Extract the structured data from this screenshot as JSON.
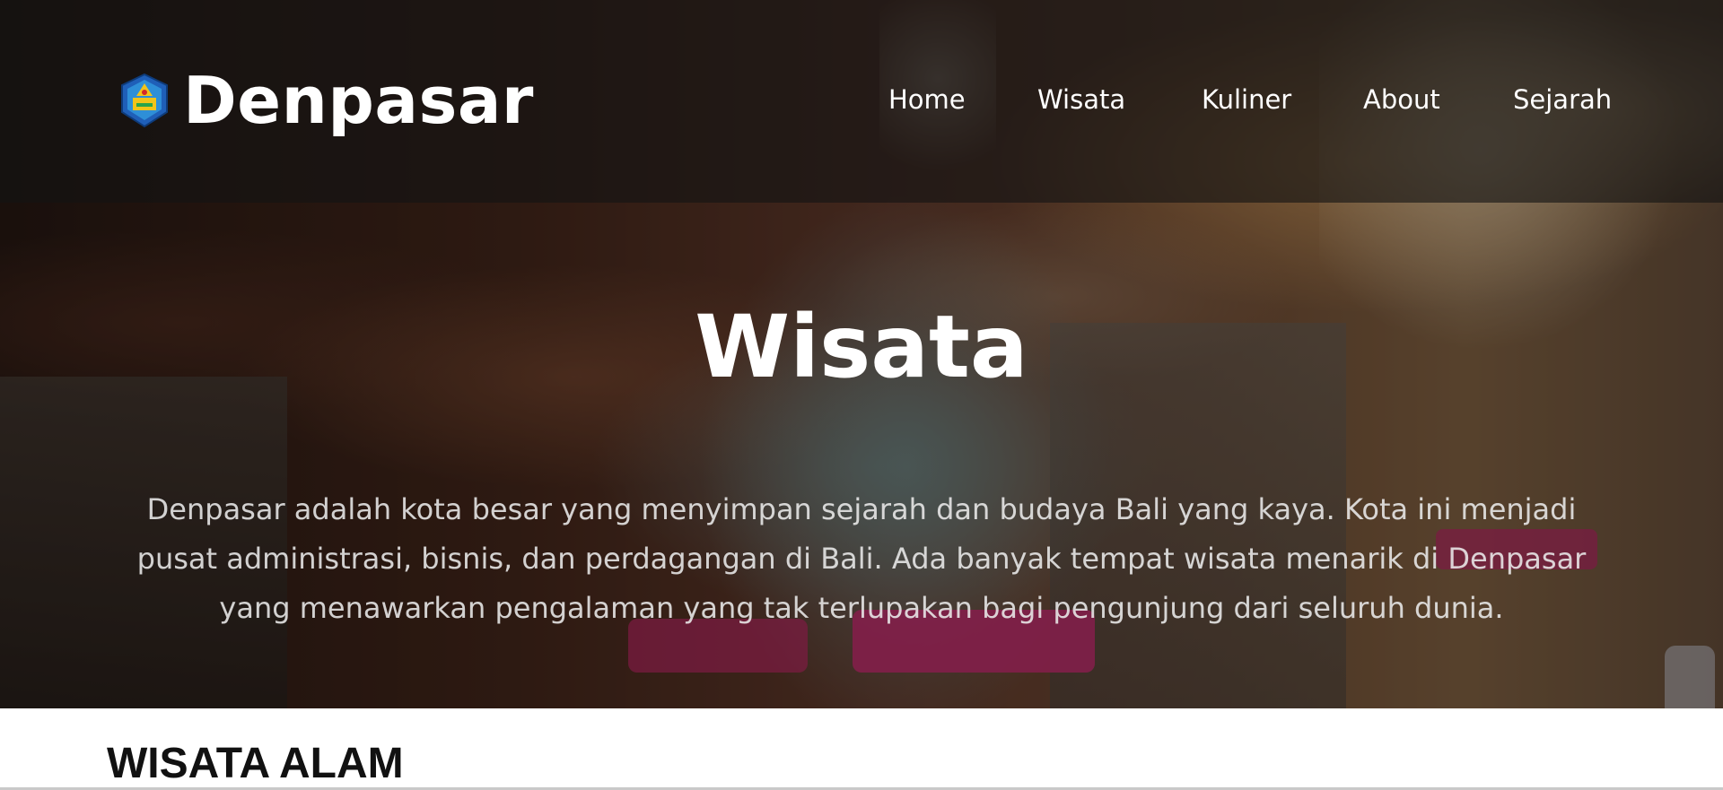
{
  "header": {
    "brand_name": "Denpasar",
    "logo_icon": "denpasar-emblem-icon",
    "nav": [
      {
        "label": "Home"
      },
      {
        "label": "Wisata"
      },
      {
        "label": "Kuliner"
      },
      {
        "label": "About"
      },
      {
        "label": "Sejarah"
      }
    ]
  },
  "hero": {
    "title": "Wisata",
    "description": "Denpasar adalah kota besar yang menyimpan sejarah dan budaya Bali yang kaya. Kota ini menjadi pusat administrasi, bisnis, dan perdagangan di Bali. Ada banyak tempat wisata menarik di Denpasar yang menawarkan pengalaman yang tak terlupakan bagi pengunjung dari seluruh dunia."
  },
  "section": {
    "title": "WISATA ALAM"
  },
  "colors": {
    "nav_bar_bg": "#141414",
    "text_primary": "#ffffff",
    "accent_sash": "#d8307a"
  }
}
